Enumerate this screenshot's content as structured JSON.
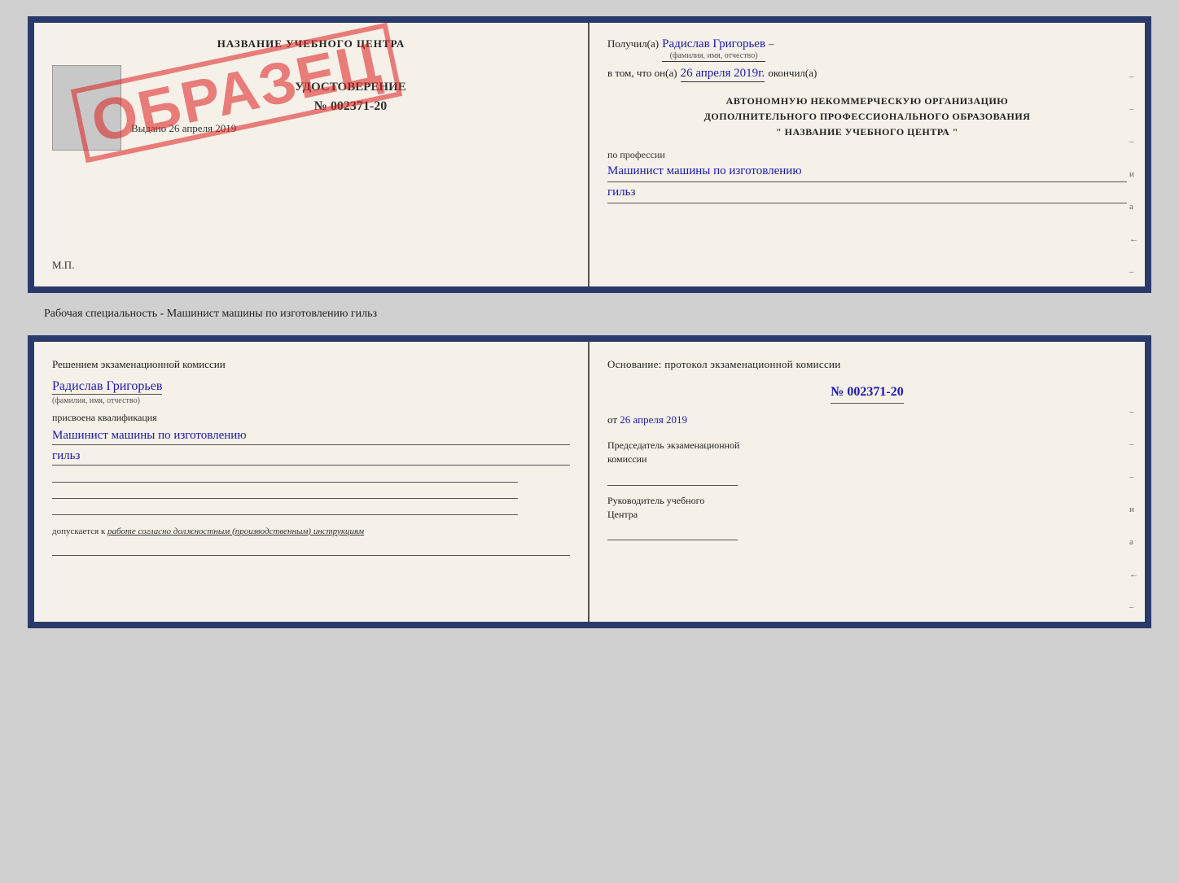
{
  "page": {
    "background": "#d0d0d0"
  },
  "caption": "Рабочая специальность - Машинист машины по изготовлению гильз",
  "topDoc": {
    "left": {
      "centerName": "НАЗВАНИЕ УЧЕБНОГО ЦЕНТРА",
      "certTitle": "УДОСТОВЕРЕНИЕ",
      "certNumber": "№ 002371-20",
      "issuedLabel": "Выдано",
      "issuedDate": "26 апреля 2019",
      "mpLabel": "М.П.",
      "stamp": "ОБРАЗЕЦ"
    },
    "right": {
      "receivedLabel": "Получил(а)",
      "receivedName": "Радислав Григорьев",
      "nameSub": "(фамилия, имя, отчество)",
      "inThatLabel": "в том, что он(а)",
      "date": "26 апреля 2019г.",
      "finishedLabel": "окончил(а)",
      "orgLine1": "АВТОНОМНУЮ НЕКОММЕРЧЕСКУЮ ОРГАНИЗАЦИЮ",
      "orgLine2": "ДОПОЛНИТЕЛЬНОГО ПРОФЕССИОНАЛЬНОГО ОБРАЗОВАНИЯ",
      "orgLine3": "\"  НАЗВАНИЕ УЧЕБНОГО ЦЕНТРА  \"",
      "professionLabel": "по профессии",
      "professionValue1": "Машинист машины по изготовлению",
      "professionValue2": "гильз",
      "sideMarks": [
        "-",
        "-",
        "-",
        "и",
        "а",
        "←",
        "-",
        "-",
        "-"
      ]
    }
  },
  "bottomDoc": {
    "left": {
      "sectionTitle": "Решением  экзаменационной  комиссии",
      "name": "Радислав Григорьев",
      "nameSub": "(фамилия, имя, отчество)",
      "qualLabel": "присвоена квалификация",
      "qualValue1": "Машинист  машины  по  изготовлению",
      "qualValue2": "гильз",
      "dopuskLabel": "допускается к",
      "dopuskValue": "работе согласно должностным (производственным) инструкциям"
    },
    "right": {
      "osnTitle": "Основание: протокол экзаменационной  комиссии",
      "protoNum": "№  002371-20",
      "fromLabel": "от",
      "fromDate": "26 апреля 2019",
      "chairmanLabel1": "Председатель экзаменационной",
      "chairmanLabel2": "комиссии",
      "headLabel1": "Руководитель учебного",
      "headLabel2": "Центра",
      "sideMarks": [
        "-",
        "-",
        "-",
        "и",
        "а",
        "←",
        "-",
        "-",
        "-"
      ]
    }
  }
}
